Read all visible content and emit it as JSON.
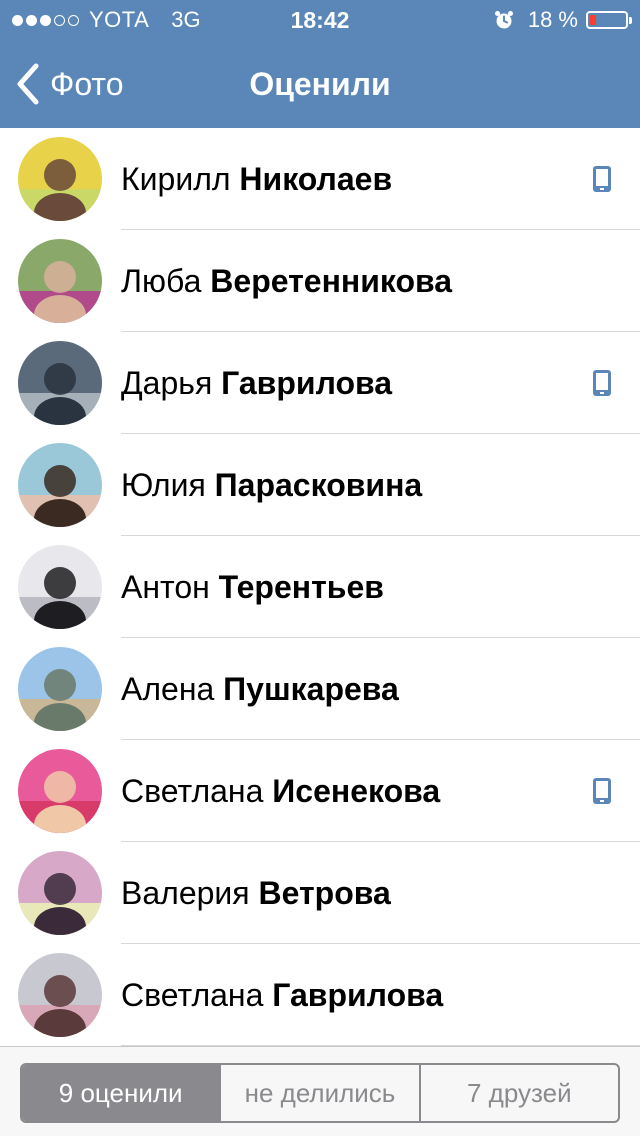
{
  "status_bar": {
    "carrier": "YOTA",
    "network": "3G",
    "time": "18:42",
    "battery": "18 %",
    "battery_level": 0.18,
    "signal_bars": 3,
    "signal_total": 5
  },
  "nav": {
    "back_label": "Фото",
    "title": "Оценили"
  },
  "users": [
    {
      "first": "Кирилл",
      "last": "Николаев",
      "mobile": true
    },
    {
      "first": "Люба",
      "last": "Веретенникова",
      "mobile": false
    },
    {
      "first": "Дарья",
      "last": "Гаврилова",
      "mobile": true
    },
    {
      "first": "Юлия",
      "last": "Парасковина",
      "mobile": false
    },
    {
      "first": "Антон",
      "last": "Терентьев",
      "mobile": false
    },
    {
      "first": "Алена",
      "last": "Пушкарева",
      "mobile": false
    },
    {
      "first": "Светлана",
      "last": "Исенекова",
      "mobile": true
    },
    {
      "first": "Валерия",
      "last": "Ветрова",
      "mobile": false
    },
    {
      "first": "Светлана",
      "last": "Гаврилова",
      "mobile": false
    }
  ],
  "segments": [
    {
      "label": "9 оценили",
      "active": true
    },
    {
      "label": "не делились",
      "active": false
    },
    {
      "label": "7 друзей",
      "active": false
    }
  ],
  "colors": {
    "header": "#5a87b8",
    "mobile_icon": "#5a87b8",
    "segment": "#8a8a8e",
    "battery_low": "#ff3b30"
  }
}
